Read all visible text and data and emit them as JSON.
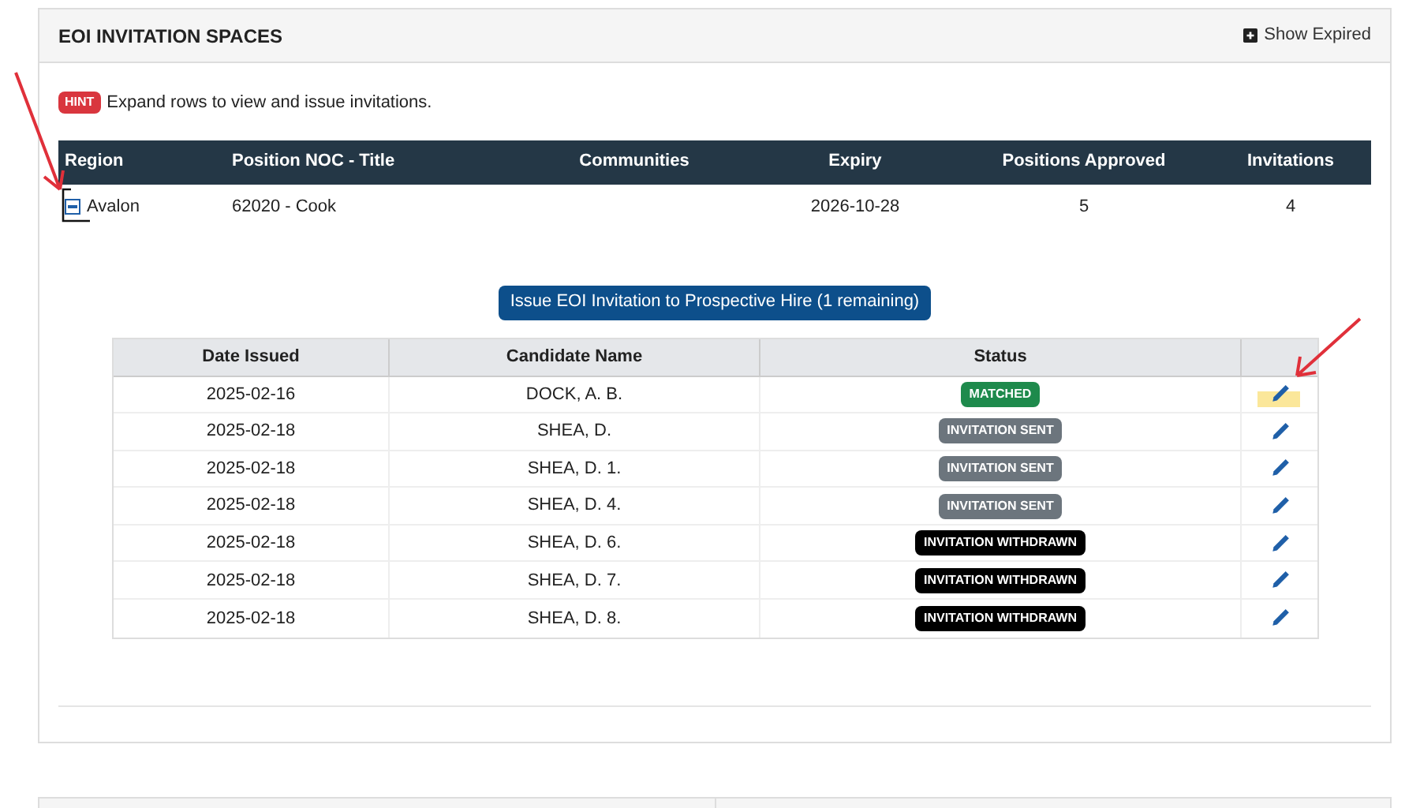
{
  "panel": {
    "title": "EOI INVITATION SPACES",
    "show_expired": "Show Expired"
  },
  "hint": {
    "badge": "HINT",
    "text": "Expand rows to view and issue invitations."
  },
  "table": {
    "columns": [
      "Region",
      "Position NOC - Title",
      "Communities",
      "Expiry",
      "Positions Approved",
      "Invitations"
    ],
    "rows": [
      {
        "expanded": true,
        "region": "Avalon",
        "position": "62020 - Cook",
        "expiry": "2026-10-28",
        "positions_approved": "5",
        "invitations": "4"
      }
    ]
  },
  "issue_button": "Issue EOI Invitation to Prospective Hire (1 remaining)",
  "invitations": {
    "columns": [
      "Date Issued",
      "Candidate Name",
      "Status"
    ],
    "rows": [
      {
        "date": "2025-02-16",
        "name": "DOCK, A. B.",
        "status": "MATCHED",
        "kind": "matched",
        "highlighted": true
      },
      {
        "date": "2025-02-18",
        "name": "SHEA, D.",
        "status": "INVITATION SENT",
        "kind": "sent",
        "highlighted": false
      },
      {
        "date": "2025-02-18",
        "name": "SHEA, D. 1.",
        "status": "INVITATION SENT",
        "kind": "sent",
        "highlighted": false
      },
      {
        "date": "2025-02-18",
        "name": "SHEA, D. 4.",
        "status": "INVITATION SENT",
        "kind": "sent",
        "highlighted": false
      },
      {
        "date": "2025-02-18",
        "name": "SHEA, D. 6.",
        "status": "INVITATION WITHDRAWN",
        "kind": "withdrawn",
        "highlighted": false
      },
      {
        "date": "2025-02-18",
        "name": "SHEA, D. 7.",
        "status": "INVITATION WITHDRAWN",
        "kind": "withdrawn",
        "highlighted": false
      },
      {
        "date": "2025-02-18",
        "name": "SHEA, D. 8.",
        "status": "INVITATION WITHDRAWN",
        "kind": "withdrawn",
        "highlighted": false
      }
    ]
  }
}
